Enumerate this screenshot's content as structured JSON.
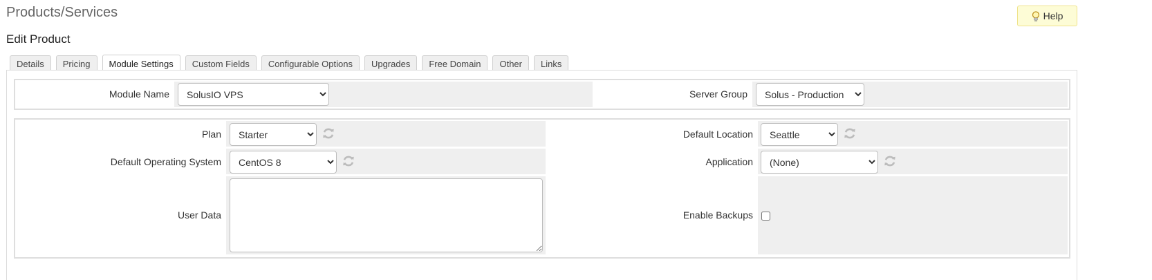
{
  "page": {
    "title": "Products/Services",
    "subtitle": "Edit Product",
    "help_label": "Help"
  },
  "tabs": [
    {
      "label": "Details"
    },
    {
      "label": "Pricing"
    },
    {
      "label": "Module Settings",
      "active": true
    },
    {
      "label": "Custom Fields"
    },
    {
      "label": "Configurable Options"
    },
    {
      "label": "Upgrades"
    },
    {
      "label": "Free Domain"
    },
    {
      "label": "Other"
    },
    {
      "label": "Links"
    }
  ],
  "module_panel": {
    "module_name_label": "Module Name",
    "module_name_value": "SolusIO VPS",
    "server_group_label": "Server Group",
    "server_group_value": "Solus - Production"
  },
  "config_panel": {
    "plan_label": "Plan",
    "plan_value": "Starter",
    "default_location_label": "Default Location",
    "default_location_value": "Seattle",
    "default_os_label": "Default Operating System",
    "default_os_value": "CentOS 8",
    "application_label": "Application",
    "application_value": "(None)",
    "user_data_label": "User Data",
    "user_data_value": "",
    "enable_backups_label": "Enable Backups",
    "enable_backups_checked": false
  },
  "icons": {
    "help": "lightbulb-icon",
    "refresh": "refresh-icon"
  },
  "colors": {
    "help_bg": "#fdfcd6",
    "help_border": "#efe38a",
    "field_cell_bg": "#efefef",
    "panel_border": "#dedede"
  }
}
